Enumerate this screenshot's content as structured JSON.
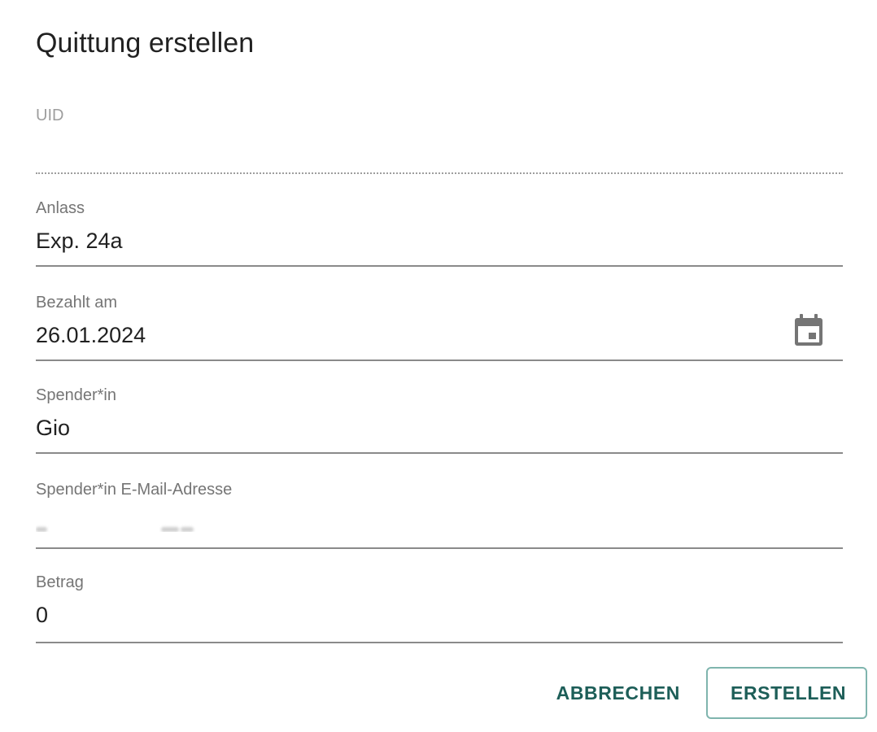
{
  "dialog": {
    "title": "Quittung erstellen"
  },
  "fields": {
    "uid": {
      "label": "UID",
      "value": ""
    },
    "anlass": {
      "label": "Anlass",
      "value": "Exp. 24a"
    },
    "bezahlt_am": {
      "label": "Bezahlt am",
      "value": "26.01.2024",
      "icon": "calendar-icon"
    },
    "spender": {
      "label": "Spender*in",
      "value": "Gio"
    },
    "email": {
      "label": "Spender*in E-Mail-Adresse"
    },
    "betrag": {
      "label": "Betrag",
      "value": "0"
    }
  },
  "actions": {
    "cancel_label": "ABBRECHEN",
    "create_label": "ERSTELLEN"
  },
  "colors": {
    "accent": "#1d5e58",
    "outline": "#7fb5ae"
  }
}
